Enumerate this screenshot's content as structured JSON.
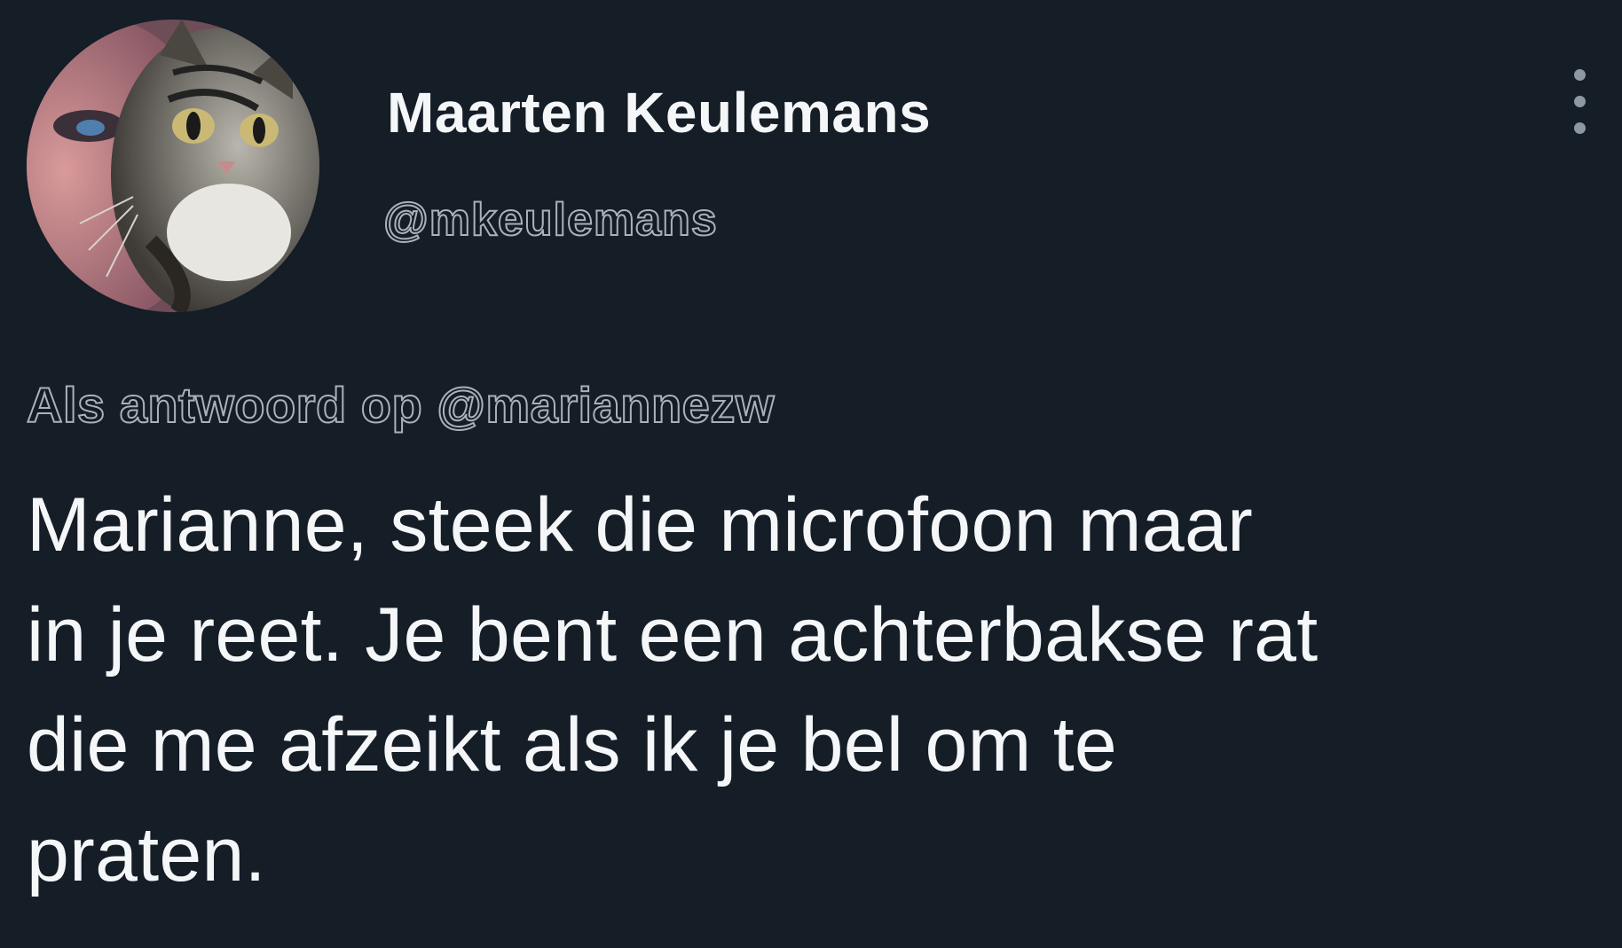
{
  "author": {
    "display_name": "Maarten Keulemans",
    "handle": "@mkeulemans",
    "avatar_icon": "profile-photo-cat"
  },
  "reply_context": {
    "prefix": "Als antwoord op ",
    "mention": "@mariannezw"
  },
  "tweet": {
    "text": "Marianne, steek die microfoon maar\nin je reet. Je bent een achterbakse rat\ndie me afzeikt als ik je bel om te\npraten."
  },
  "menu": {
    "icon": "more-vertical-icon"
  },
  "colors": {
    "background": "#151d27",
    "text": "#f4f6f8",
    "secondary_text": "#a9b1ba",
    "menu_dots": "#8e98a3"
  }
}
